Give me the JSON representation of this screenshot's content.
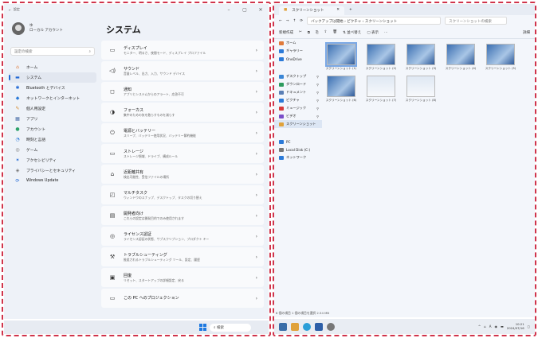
{
  "settings": {
    "title": "設定",
    "user": {
      "line1": "ゆ",
      "line2": "ローカル アカウント"
    },
    "search_placeholder": "設定の検索",
    "nav": [
      {
        "label": "ホーム",
        "icon": "⌂",
        "color": "#e07a3a"
      },
      {
        "label": "システム",
        "icon": "▬",
        "color": "#2168d5"
      },
      {
        "label": "Bluetooth とデバイス",
        "icon": "✱",
        "color": "#2168d5"
      },
      {
        "label": "ネットワークとインターネット",
        "icon": "◆",
        "color": "#2b7ad8"
      },
      {
        "label": "個人用設定",
        "icon": "✎",
        "color": "#d68a2e"
      },
      {
        "label": "アプリ",
        "icon": "▦",
        "color": "#4a6fa8"
      },
      {
        "label": "アカウント",
        "icon": "●",
        "color": "#2ea36b"
      },
      {
        "label": "時刻と言語",
        "icon": "◔",
        "color": "#2b7ad8"
      },
      {
        "label": "ゲーム",
        "icon": "◎",
        "color": "#777"
      },
      {
        "label": "アクセシビリティ",
        "icon": "✶",
        "color": "#2168d5"
      },
      {
        "label": "プライバシーとセキュリティ",
        "icon": "◈",
        "color": "#777"
      },
      {
        "label": "Windows Update",
        "icon": "⟳",
        "color": "#2168d5"
      }
    ],
    "page_title": "システム",
    "rows": [
      {
        "icon": "▭",
        "title": "ディスプレイ",
        "sub": "モニター、明るさ、夜間モード、ディスプレイ プロファイル"
      },
      {
        "icon": "◁)",
        "title": "サウンド",
        "sub": "音量レベル、出力、入力、サウンド デバイス"
      },
      {
        "icon": "◻",
        "title": "通知",
        "sub": "アプリとシステムからのアラート、応答不可"
      },
      {
        "icon": "◑",
        "title": "フォーカス",
        "sub": "集中のための気を散らすものを減らす"
      },
      {
        "icon": "⏻",
        "title": "電源とバッテリー",
        "sub": "スリープ、バッテリー使用状況、バッテリー節約機能"
      },
      {
        "icon": "▭",
        "title": "ストレージ",
        "sub": "ストレージ領域、ドライブ、構成ルール"
      },
      {
        "icon": "⌂",
        "title": "近距離共有",
        "sub": "検出可能性、受信ファイルの場所"
      },
      {
        "icon": "◰",
        "title": "マルチタスク",
        "sub": "ウィンドウのスナップ、デスクトップ、タスクの切り替え"
      },
      {
        "icon": "▤",
        "title": "開発者向け",
        "sub": "これらの設定は開発目的でのみ使用されます"
      },
      {
        "icon": "◎",
        "title": "ライセンス認証",
        "sub": "ライセンス認証の状態、サブスクリプション、プロダクト キー"
      },
      {
        "icon": "⚒",
        "title": "トラブルシューティング",
        "sub": "推奨されるトラブルシューティング ツール、設定、履歴"
      },
      {
        "icon": "▣",
        "title": "回復",
        "sub": "リセット、スタートアップの詳細設定、戻る"
      },
      {
        "icon": "▭",
        "title": "この PC へのプロジェクション",
        "sub": ""
      }
    ],
    "taskbar_search": "検索"
  },
  "explorer": {
    "tab": "スクリーンショット",
    "breadcrumb": "›  ピクチャ  ›  スクリーンショット",
    "breadcrumb_lead": "バックアップは開始",
    "search_placeholder": "スクリーンショットの検索",
    "cmd": [
      "新規作成",
      "✂",
      "⧉",
      "⎘",
      "⇪",
      "🗑",
      "⇅ 並べ替え",
      "▢ 表示",
      "…"
    ],
    "details": "詳細",
    "sidebar": [
      {
        "label": "ホーム",
        "color": "#e07a3a",
        "pin": false
      },
      {
        "label": "ギャラリー",
        "color": "#2b7ad8",
        "pin": false
      },
      {
        "label": "OneDrive",
        "color": "#2b7ad8",
        "pin": false
      },
      {
        "gap": true
      },
      {
        "label": "デスクトップ",
        "color": "#3a86d6",
        "pin": true
      },
      {
        "label": "ダウンロード",
        "color": "#2e9b5e",
        "pin": true
      },
      {
        "label": "ドキュメント",
        "color": "#5a7fb5",
        "pin": true
      },
      {
        "label": "ピクチャ",
        "color": "#2b7ad8",
        "pin": true
      },
      {
        "label": "ミュージック",
        "color": "#d63a3a",
        "pin": true
      },
      {
        "label": "ビデオ",
        "color": "#7a4fc9",
        "pin": true
      },
      {
        "label": "スクリーンショット",
        "color": "#e0a23a",
        "pin": false,
        "active": true
      },
      {
        "gap": true
      },
      {
        "label": "PC",
        "color": "#2b7ad8",
        "pin": false
      },
      {
        "label": "Local Disk (C:)",
        "color": "#777",
        "pin": false
      },
      {
        "label": "ネットワーク",
        "color": "#2b7ad8",
        "pin": false
      }
    ],
    "files": [
      {
        "name": "スクリーンショット (1)",
        "sel": true
      },
      {
        "name": "スクリーンショット (2)"
      },
      {
        "name": "スクリーンショット (3)"
      },
      {
        "name": "スクリーンショット (4)"
      },
      {
        "name": "スクリーンショット (5)"
      },
      {
        "name": "スクリーンショット (6)"
      },
      {
        "name": "スクリーンショット (7)",
        "alt": true
      },
      {
        "name": "スクリーンショット (8)",
        "alt": true
      }
    ],
    "status": "8 個の項目  1 個の項目を選択  2.54 MB",
    "clock": {
      "time": "10:21",
      "date": "2024/07/16"
    }
  }
}
